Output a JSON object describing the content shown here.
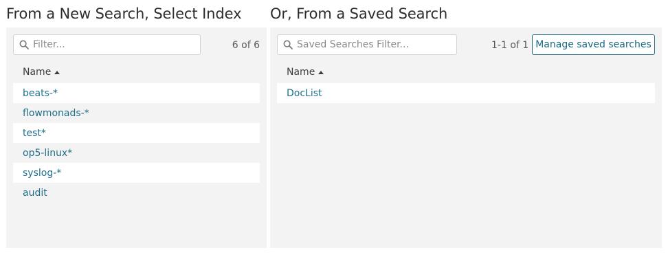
{
  "left": {
    "title": "From a New Search, Select Index",
    "filter_placeholder": "Filter...",
    "count": "6 of 6",
    "column_header": "Name",
    "items": [
      "beats-*",
      "flowmonads-*",
      "test*",
      "op5-linux*",
      "syslog-*",
      "audit"
    ]
  },
  "right": {
    "title": "Or, From a Saved Search",
    "filter_placeholder": "Saved Searches Filter...",
    "count": "1-1 of 1",
    "manage_button_label": "Manage saved searches",
    "column_header": "Name",
    "items": [
      "DocList"
    ]
  },
  "icons": {
    "search": "search-icon",
    "sort": "sort-ascending-icon"
  },
  "colors": {
    "link": "#1f6f8b",
    "panel_bg": "#f3f3f3",
    "button_border": "#23708a"
  }
}
